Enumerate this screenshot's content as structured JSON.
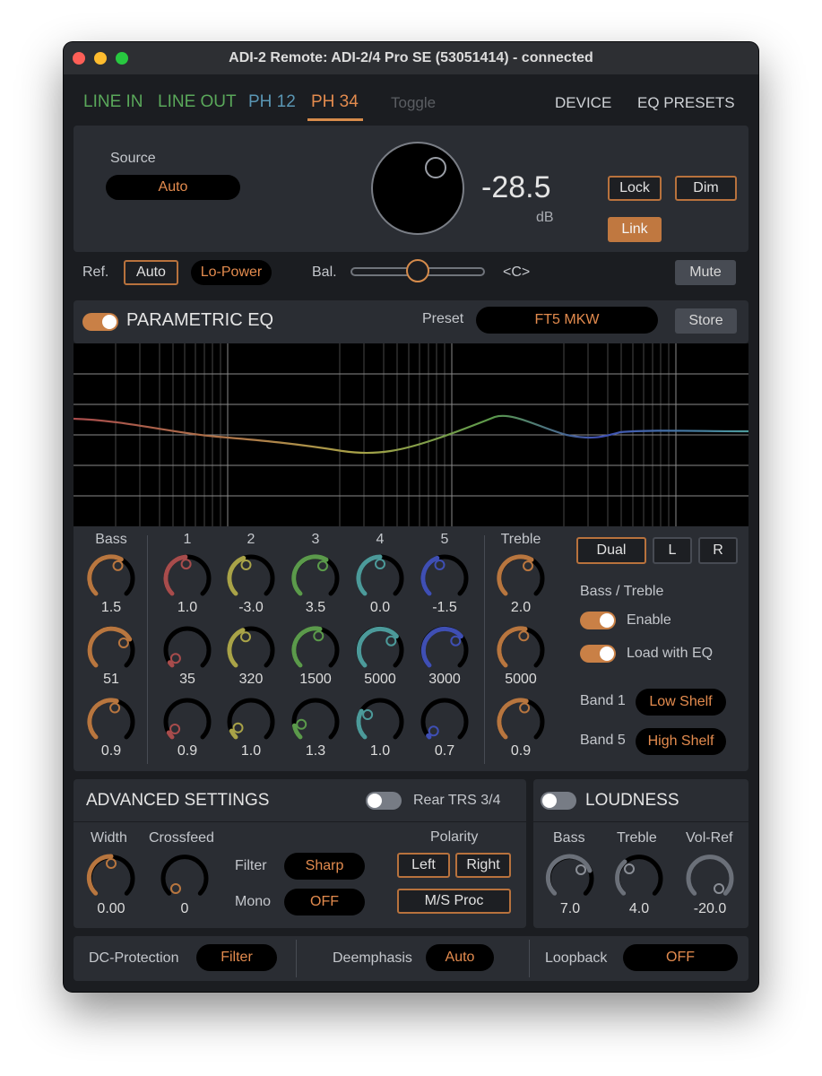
{
  "window": {
    "title": "ADI-2 Remote: ADI-2/4 Pro SE (53051414) - connected"
  },
  "tabs": [
    {
      "label": "LINE IN",
      "color": "#5aa85a"
    },
    {
      "label": "LINE OUT",
      "color": "#5aa85a"
    },
    {
      "label": "PH 12",
      "color": "#5a96b4"
    },
    {
      "label": "PH 34",
      "color": "#e38b4e"
    },
    {
      "label": "Toggle",
      "color": "#5b5e63"
    },
    {
      "label": "DEVICE",
      "color": "#cfd2d6"
    },
    {
      "label": "EQ PRESETS",
      "color": "#cfd2d6"
    }
  ],
  "volume": {
    "source_label": "Source",
    "source_value": "Auto",
    "value": "-28.5",
    "unit": "dB",
    "lock_label": "Lock",
    "dim_label": "Dim",
    "link_label": "Link"
  },
  "ref": {
    "label": "Ref.",
    "auto_label": "Auto",
    "lopower_label": "Lo-Power",
    "bal_label": "Bal.",
    "bal_value": "<C>",
    "bal_fraction": 0.5,
    "mute_label": "Mute"
  },
  "peq": {
    "title": "PARAMETRIC EQ",
    "enabled": true,
    "preset_label": "Preset",
    "preset_value": "FT5 MKW",
    "store_label": "Store"
  },
  "bands": {
    "headers": [
      "Bass",
      "1",
      "2",
      "3",
      "4",
      "5",
      "Treble"
    ],
    "colors": [
      "#b8763f",
      "#a84c4c",
      "#a9a348",
      "#5b9a4b",
      "#4c9a9a",
      "#3f4fb4",
      "#b8763f"
    ],
    "gain": [
      "1.5",
      "1.0",
      "-3.0",
      "3.5",
      "0.0",
      "-1.5",
      "2.0"
    ],
    "freq": [
      "51",
      "35",
      "320",
      "1500",
      "5000",
      "3000",
      "5000"
    ],
    "q": [
      "0.9",
      "0.9",
      "1.0",
      "1.3",
      "1.0",
      "0.7",
      "0.9"
    ]
  },
  "channel": {
    "dual_label": "Dual",
    "l_label": "L",
    "r_label": "R"
  },
  "bass_treble": {
    "title": "Bass / Treble",
    "enable_label": "Enable",
    "load_label": "Load with EQ",
    "band1_label": "Band 1",
    "band1_value": "Low Shelf",
    "band5_label": "Band 5",
    "band5_value": "High Shelf"
  },
  "advanced": {
    "title": "ADVANCED SETTINGS",
    "rear_trs_label": "Rear TRS 3/4",
    "width_label": "Width",
    "width_value": "0.00",
    "crossfeed_label": "Crossfeed",
    "crossfeed_value": "0",
    "filter_label": "Filter",
    "filter_value": "Sharp",
    "mono_label": "Mono",
    "mono_value": "OFF",
    "polarity_label": "Polarity",
    "left_label": "Left",
    "right_label": "Right",
    "msproc_label": "M/S Proc"
  },
  "loudness": {
    "title": "LOUDNESS",
    "bass_label": "Bass",
    "bass_value": "7.0",
    "treble_label": "Treble",
    "treble_value": "4.0",
    "volref_label": "Vol-Ref",
    "volref_value": "-20.0"
  },
  "bottom": {
    "dc_label": "DC-Protection",
    "dc_value": "Filter",
    "deemph_label": "Deemphasis",
    "deemph_value": "Auto",
    "loopback_label": "Loopback",
    "loopback_value": "OFF"
  }
}
